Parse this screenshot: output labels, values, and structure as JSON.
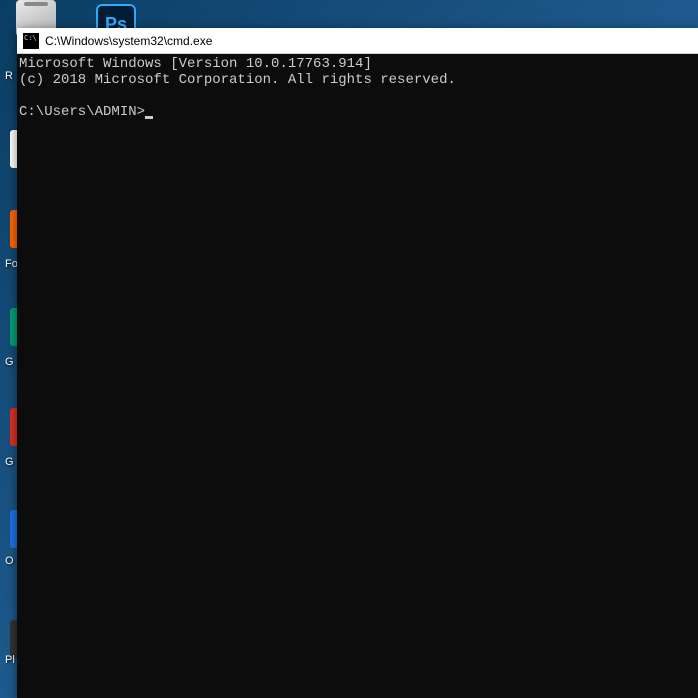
{
  "desktop": {
    "recycle_label": "R",
    "ps_text": "Ps",
    "partial1_label": "Fo",
    "partial2_label": "G",
    "partial3_label": "G",
    "partial4_label": "O",
    "partial5_label": "Pl"
  },
  "cmd": {
    "title": "C:\\Windows\\system32\\cmd.exe",
    "line1": "Microsoft Windows [Version 10.0.17763.914]",
    "line2": "(c) 2018 Microsoft Corporation. All rights reserved.",
    "prompt": "C:\\Users\\ADMIN>"
  }
}
